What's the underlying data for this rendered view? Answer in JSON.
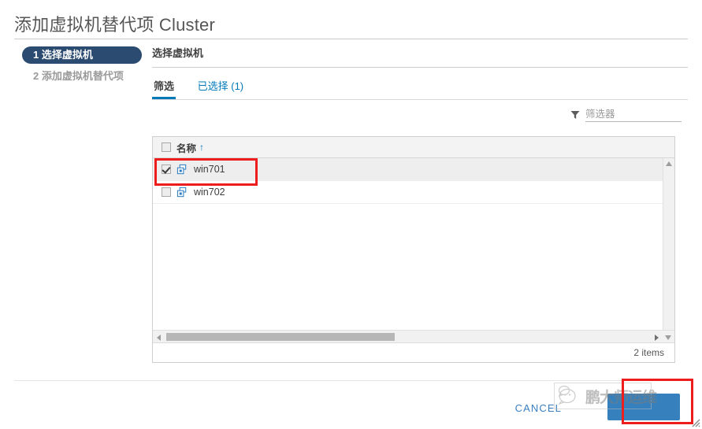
{
  "dialog": {
    "title": "添加虚拟机替代项 Cluster"
  },
  "steps": {
    "items": [
      {
        "label": "1 选择虚拟机",
        "active": true
      },
      {
        "label": "2 添加虚拟机替代项",
        "active": false
      }
    ]
  },
  "content": {
    "heading": "选择虚拟机",
    "tabs": [
      {
        "label": "筛选",
        "active": true
      },
      {
        "label": "已选择 (1)",
        "active": false
      }
    ],
    "filter": {
      "icon": "funnel-icon",
      "placeholder": "筛选器",
      "value": ""
    },
    "table": {
      "columns": [
        "名称"
      ],
      "sort": {
        "column": "名称",
        "direction": "↑"
      },
      "header_checkbox_checked": false,
      "rows": [
        {
          "name": "win701",
          "checked": true,
          "icon": "virtual-machine-icon"
        },
        {
          "name": "win702",
          "checked": false,
          "icon": "virtual-machine-icon"
        }
      ],
      "footer_count": "2 items"
    }
  },
  "footer": {
    "cancel_label": "CANCEL",
    "primary_label": ""
  },
  "watermark": {
    "text": "鹏大师运维"
  },
  "colors": {
    "accent": "#0079b8",
    "primary_button": "#3680bd",
    "step_active": "#2b4b70",
    "annotation": "#ee1d1d",
    "title": "#565656"
  }
}
